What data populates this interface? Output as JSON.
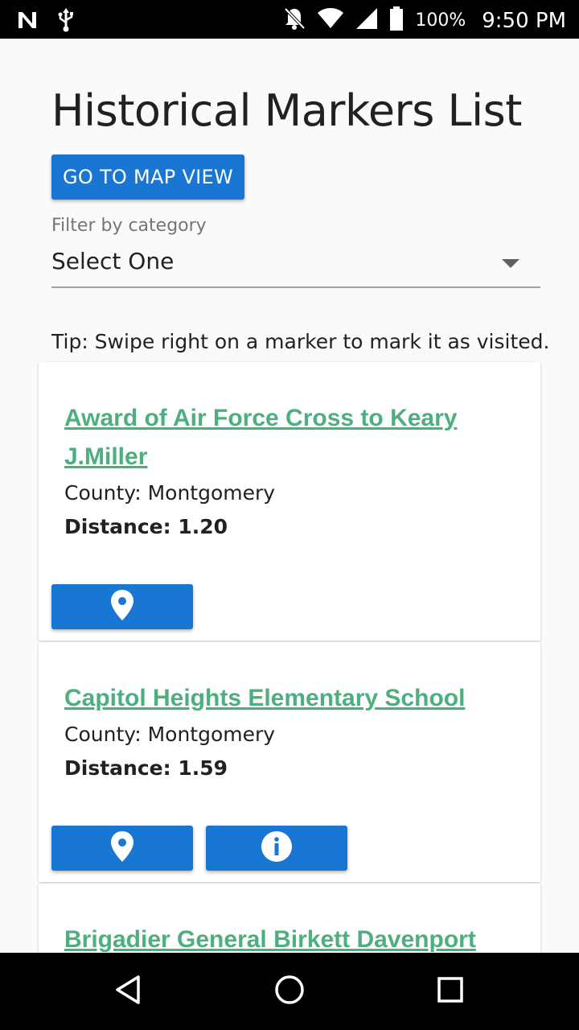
{
  "status_bar": {
    "battery_percent": "100%",
    "time": "9:50 PM",
    "icons": [
      "n-icon",
      "usb-icon",
      "bell-off-icon",
      "wifi-icon",
      "signal-icon",
      "battery-icon"
    ]
  },
  "page": {
    "title": "Historical Markers List",
    "map_button_label": "GO TO MAP VIEW",
    "filter": {
      "label": "Filter by category",
      "selected": "Select One"
    },
    "tip": "Tip: Swipe right on a marker to mark it as visited."
  },
  "markers": [
    {
      "title": "Award of Air Force Cross to Keary J.Miller",
      "county": "County: Montgomery",
      "distance_label": "Distance:",
      "distance_value": "1.20",
      "buttons": [
        "map-pin-icon"
      ]
    },
    {
      "title": "Capitol Heights Elementary School",
      "county": "County: Montgomery",
      "distance_label": "Distance:",
      "distance_value": "1.59",
      "buttons": [
        "map-pin-icon",
        "info-icon"
      ]
    },
    {
      "title": "Brigadier General Birkett Davenport"
    }
  ],
  "nav_bar": {
    "icons": [
      "back-icon",
      "home-icon",
      "recents-icon"
    ]
  },
  "colors": {
    "primary": "#1976d2",
    "link": "#4caf7d",
    "background": "#fafafa"
  }
}
